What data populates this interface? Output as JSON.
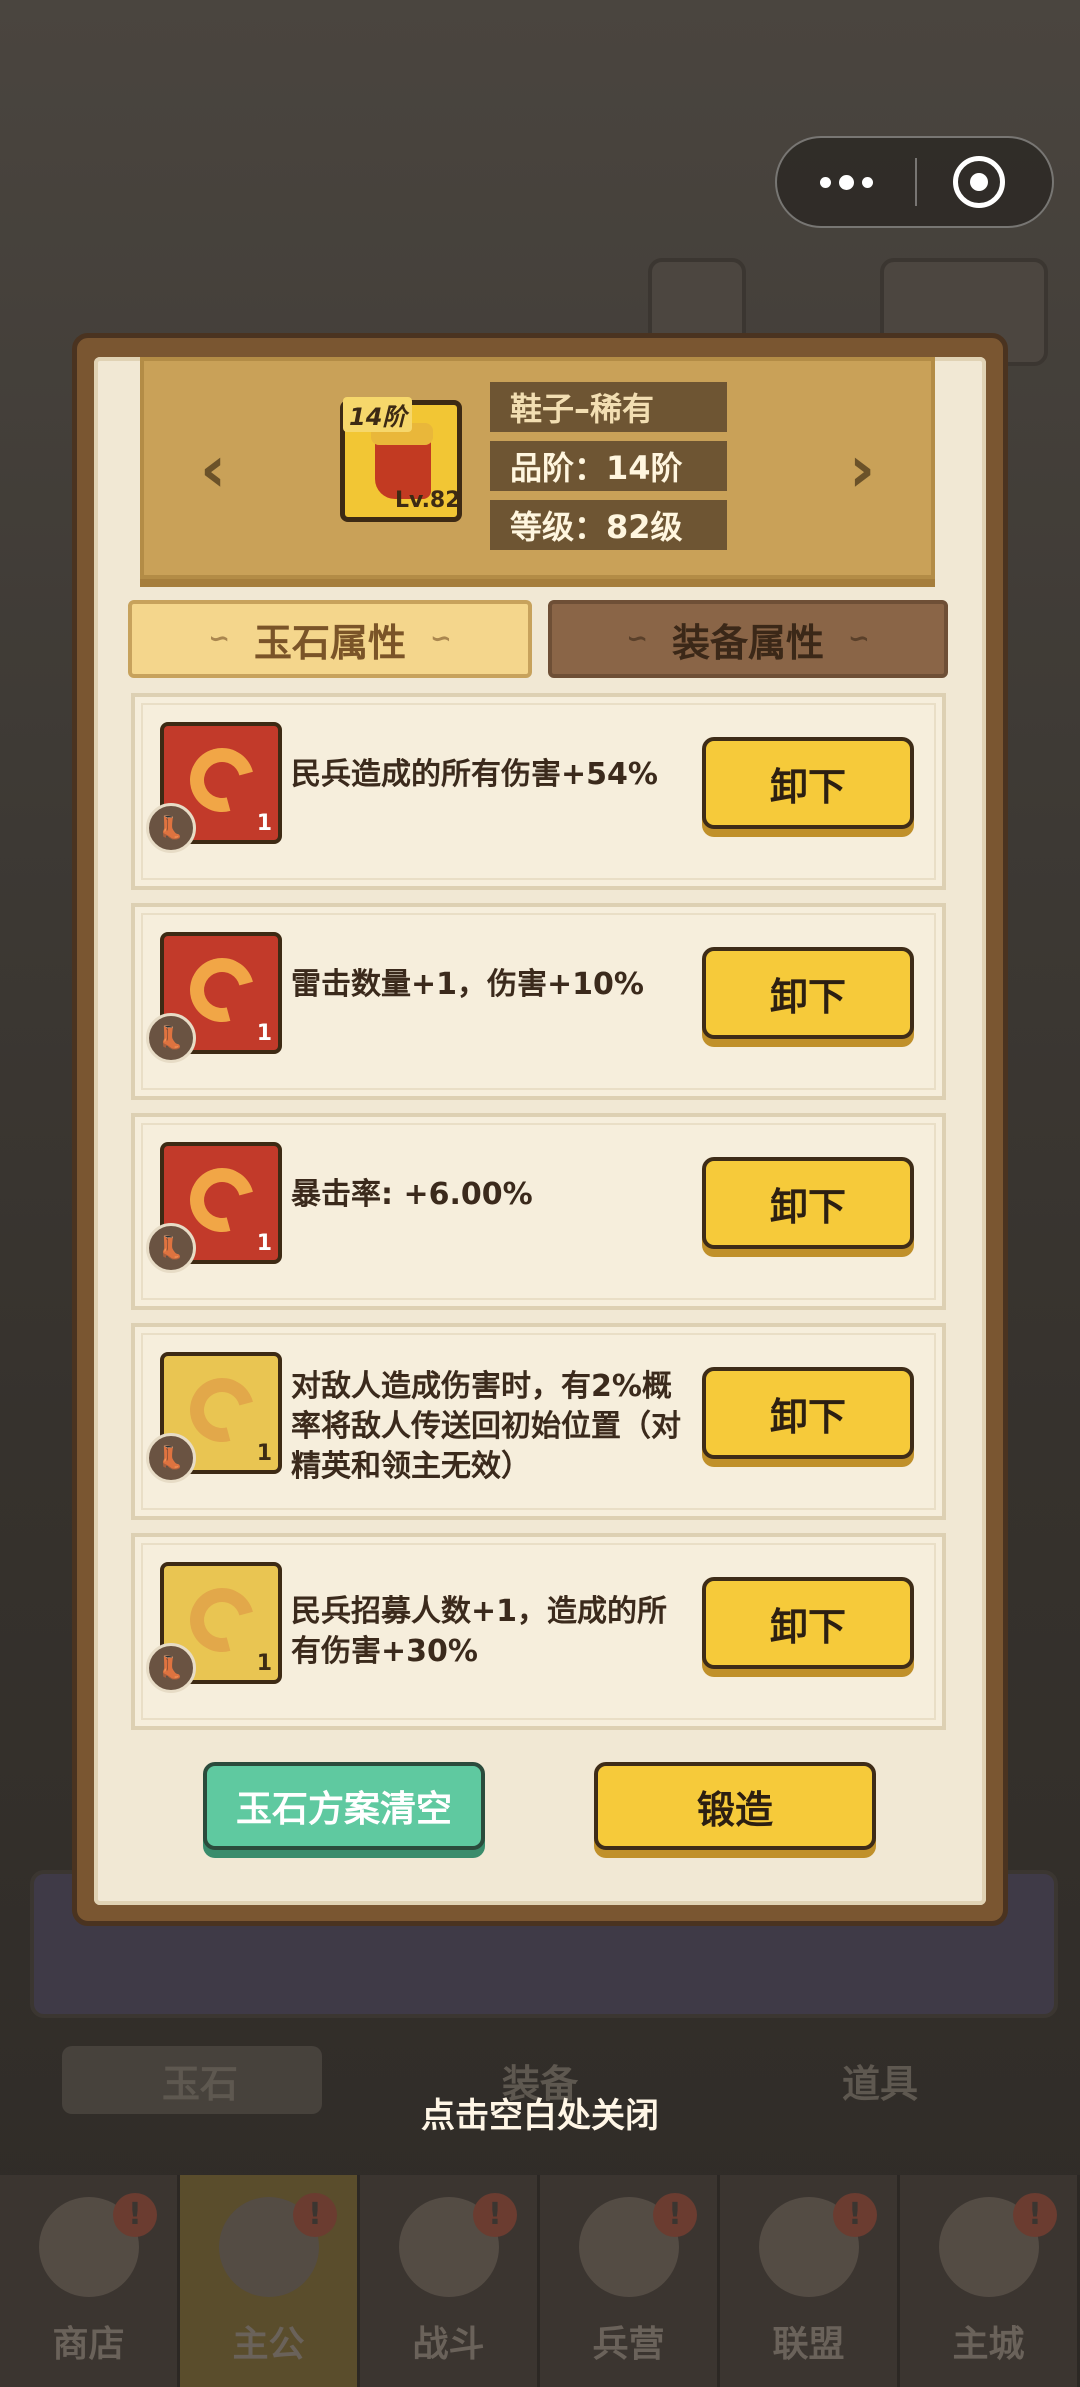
{
  "capsule": {
    "more_icon": "more-dots-icon",
    "close_icon": "target-close-icon"
  },
  "equipment": {
    "name": "鞋子–稀有",
    "tier_badge": "14阶",
    "level_badge": "Lv.82",
    "grade_line": "品阶：14阶",
    "level_line": "等级：82级",
    "icon": "red-boot-icon"
  },
  "nav_arrows": {
    "prev": "‹",
    "next": "›"
  },
  "tabs": [
    {
      "label": "玉石属性",
      "active": true
    },
    {
      "label": "装备属性",
      "active": false
    }
  ],
  "jades": [
    {
      "rarity": "red",
      "count": "1",
      "desc": "民兵造成的所有伤害+54%",
      "button": "卸下"
    },
    {
      "rarity": "red",
      "count": "1",
      "desc": "雷击数量+1，伤害+10%",
      "button": "卸下"
    },
    {
      "rarity": "red",
      "count": "1",
      "desc": "暴击率: +6.00%",
      "button": "卸下"
    },
    {
      "rarity": "gold",
      "count": "1",
      "desc": "对敌人造成伤害时，有2%概率将敌人传送回初始位置（对精英和领主无效）",
      "button": "卸下"
    },
    {
      "rarity": "gold",
      "count": "1",
      "desc": "民兵招募人数+1，造成的所有伤害+30%",
      "button": "卸下"
    }
  ],
  "actions": {
    "clear_label": "玉石方案清空",
    "forge_label": "锻造"
  },
  "close_hint": "点击空白处关闭",
  "background_tabs": [
    "玉石",
    "装备",
    "道具"
  ],
  "bottom_nav": [
    "商店",
    "主公",
    "战斗",
    "兵营",
    "联盟",
    "主城"
  ],
  "bottom_nav_active": "主公",
  "colors": {
    "accent_yellow": "#f6ca3a",
    "accent_green": "#5fc9a0",
    "paper": "#f1e8d4",
    "header_gold": "#c9a158"
  }
}
